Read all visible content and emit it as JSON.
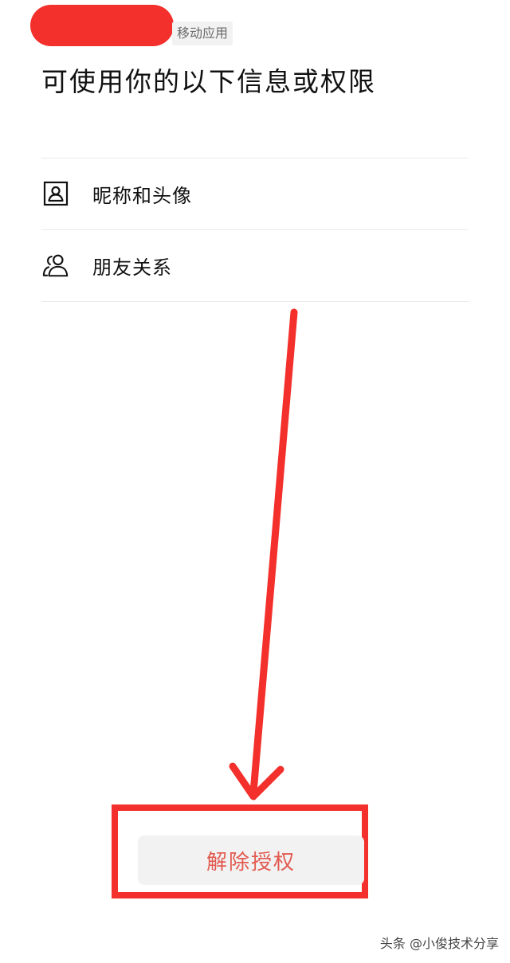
{
  "header": {
    "app_tag": "移动应用",
    "title": "可使用你的以下信息或权限"
  },
  "permissions": [
    {
      "icon": "user-portrait-icon",
      "label": "昵称和头像"
    },
    {
      "icon": "friends-icon",
      "label": "朋友关系"
    }
  ],
  "actions": {
    "revoke_label": "解除授权"
  },
  "watermark": "头条 @小俊技术分享",
  "colors": {
    "annotation_red": "#f3302b",
    "revoke_text": "#e25a50",
    "button_bg": "#f2f2f2",
    "divider": "#eaeaea"
  }
}
